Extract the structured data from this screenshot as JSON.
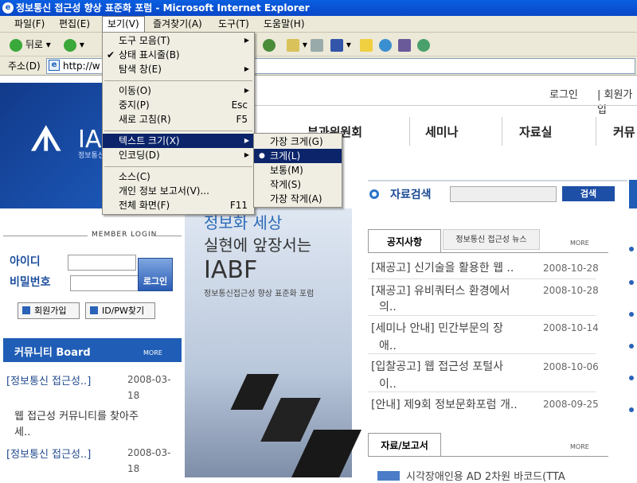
{
  "window": {
    "title": "정보통신 접근성 향상 표준화 포럼 - Microsoft Internet Explorer",
    "logo": "e"
  },
  "menubar": [
    "파일(F)",
    "편집(E)",
    "보기(V)",
    "즐겨찾기(A)",
    "도구(T)",
    "도움말(H)"
  ],
  "toolbar": {
    "back": "뒤로",
    "back_icon": "back-arrow-icon",
    "forward_icon": "forward-arrow-icon"
  },
  "address": {
    "label": "주소(D)",
    "value": "http://w"
  },
  "view_menu": {
    "items": [
      {
        "label": "도구 모음(T)",
        "arrow": "▶"
      },
      {
        "label": "상태 표시줄(B)",
        "check": "✔"
      },
      {
        "label": "탐색 창(E)",
        "arrow": "▶"
      },
      {
        "label": "이동(O)",
        "arrow": "▶"
      },
      {
        "label": "중지(P)",
        "shortcut": "Esc"
      },
      {
        "label": "새로 고침(R)",
        "shortcut": "F5"
      },
      {
        "label": "텍스트 크기(X)",
        "arrow": "▶"
      },
      {
        "label": "인코딩(D)",
        "arrow": "▶"
      },
      {
        "label": "소스(C)"
      },
      {
        "label": "개인 정보 보고서(V)..."
      },
      {
        "label": "전체 화면(F)",
        "shortcut": "F11"
      }
    ]
  },
  "text_size_menu": {
    "items": [
      {
        "label": "가장 크게(G)"
      },
      {
        "label": "크게(L)",
        "bullet": "●"
      },
      {
        "label": "보통(M)"
      },
      {
        "label": "작게(S)"
      },
      {
        "label": "가장 작게(A)"
      }
    ]
  },
  "site": {
    "logo_mark": "ᗑ",
    "logo_text": "IA",
    "logo_sub": "정보통신 접근성 향상 표준화 포럼",
    "login_link": "로그인",
    "join_link": "| 회원가입",
    "gnav": [
      "부과위원회",
      "세미나",
      "자료실",
      "커뮤"
    ],
    "hero": [
      "정보화 세상",
      "실현에 앞장서는",
      "IABF",
      "정보통신접근성 향상 표준화 포럼"
    ],
    "member_login": "MEMBER LOGIN",
    "id_label": "아이디",
    "pw_label": "비밀번호",
    "login_btn": "로그인",
    "join_btn": "회원가입",
    "find_btn": "ID/PW찾기",
    "board_title": "커뮤니티 Board",
    "more": "MORE",
    "board_items": [
      {
        "title": "[정보통신 접근성..]",
        "date": "2008-03-",
        "date2": "18",
        "body": "웹 접근성 커뮤니티를 찾아주",
        "body2": "세.."
      },
      {
        "title": "[정보통신 접근성..]",
        "date": "2008-03-",
        "date2": "18"
      }
    ],
    "search_title": "자료검색",
    "search_btn": "검색",
    "tab_notice": "공지사항",
    "tab_news": "정보통신 접근성 뉴스",
    "notices": [
      {
        "title": "[재공고] 신기술을 활용한 웹 ..",
        "date": "2008-10-28"
      },
      {
        "title": "[재공고] 유비쿼터스 환경에서",
        "title2": "의..",
        "date": "2008-10-28"
      },
      {
        "title": "[세미나 안내] 민간부문의 장",
        "title2": "애..",
        "date": "2008-10-14"
      },
      {
        "title": "[입찰공고] 웹 접근성 포털사",
        "title2": "이..",
        "date": "2008-10-06"
      },
      {
        "title": "[안내] 제9회 정보문화포럼 개..",
        "date": "2008-09-25"
      }
    ],
    "report_tab": "자료/보고서",
    "report_row": "시각장애인용 AD 2차원 바코드(TTA"
  }
}
